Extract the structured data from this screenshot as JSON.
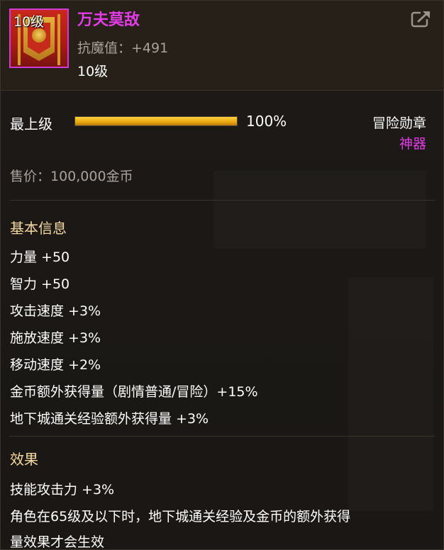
{
  "item": {
    "icon_level": "10级",
    "name": "万夫莫敌",
    "stat_label": "抗魔值：+491",
    "level": "10级",
    "name_color": "#e23ce6"
  },
  "share_icon": "share-external-icon",
  "upgrade": {
    "label": "最上级",
    "progress_percent": 100,
    "percent_text": "100%"
  },
  "category": {
    "type": "冒险勋章",
    "rarity": "神器",
    "rarity_color": "#e23ce6"
  },
  "price": "售价：100,000金币",
  "basic_info": {
    "title": "基本信息",
    "lines": [
      "力量 +50",
      "智力 +50",
      "攻击速度 +3%",
      "施放速度 +3%",
      "移动速度 +2%",
      "金币额外获得量（剧情普通/冒险）+15%",
      "地下城通关经验额外获得量 +3%"
    ]
  },
  "effect": {
    "title": "效果",
    "lines": [
      "技能攻击力 +3%",
      "角色在65级及以下时，地下城通关经验及金币的额外获得",
      "量效果才会生效"
    ]
  }
}
